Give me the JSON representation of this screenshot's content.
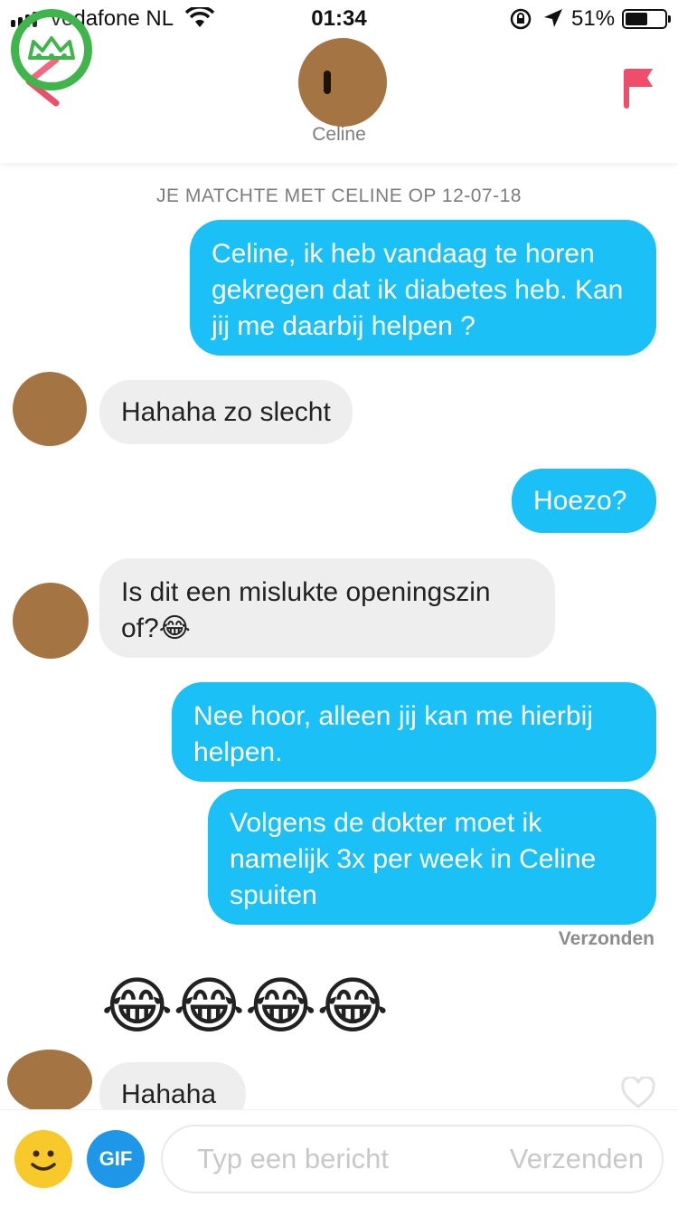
{
  "status_bar": {
    "carrier": "vodafone NL",
    "time": "01:34",
    "battery_percent": "51%",
    "battery_level": 0.51,
    "icons": [
      "signal-icon",
      "wifi-icon",
      "orientation-lock-icon",
      "location-arrow-icon",
      "battery-icon"
    ]
  },
  "header": {
    "contact_name": "Celine",
    "icons": [
      "back-chevron-icon",
      "report-flag-icon"
    ],
    "accent_color": "#ef4e6b"
  },
  "chat": {
    "match_notice": "JE MATCHTE MET CELINE OP 12-07-18",
    "messages": [
      {
        "from": "me",
        "text": "Celine, ik heb vandaag te horen gekregen dat ik diabetes heb. Kan jij me daarbij helpen ?"
      },
      {
        "from": "them",
        "text": "Hahaha zo slecht"
      },
      {
        "from": "me",
        "text": "Hoezo?"
      },
      {
        "from": "them",
        "text": "Is dit een mislukte openingszin of?😂"
      },
      {
        "from": "me",
        "text": "Nee hoor, alleen jij kan me hierbij helpen."
      },
      {
        "from": "me",
        "text": "Volgens de dokter moet ik namelijk 3x per week in Celine spuiten"
      },
      {
        "from": "them",
        "text": "😂😂😂😂"
      },
      {
        "from": "them",
        "text": "Hahaha"
      }
    ],
    "delivered_label": "Verzonden",
    "sent_bubble_color": "#1bc0f6",
    "received_bubble_color": "#eeeeee"
  },
  "compose": {
    "placeholder": "Typ een bericht",
    "send_label": "Verzenden",
    "gif_label": "GIF",
    "icons": [
      "smiley-icon",
      "gif-icon",
      "heart-icon"
    ]
  }
}
